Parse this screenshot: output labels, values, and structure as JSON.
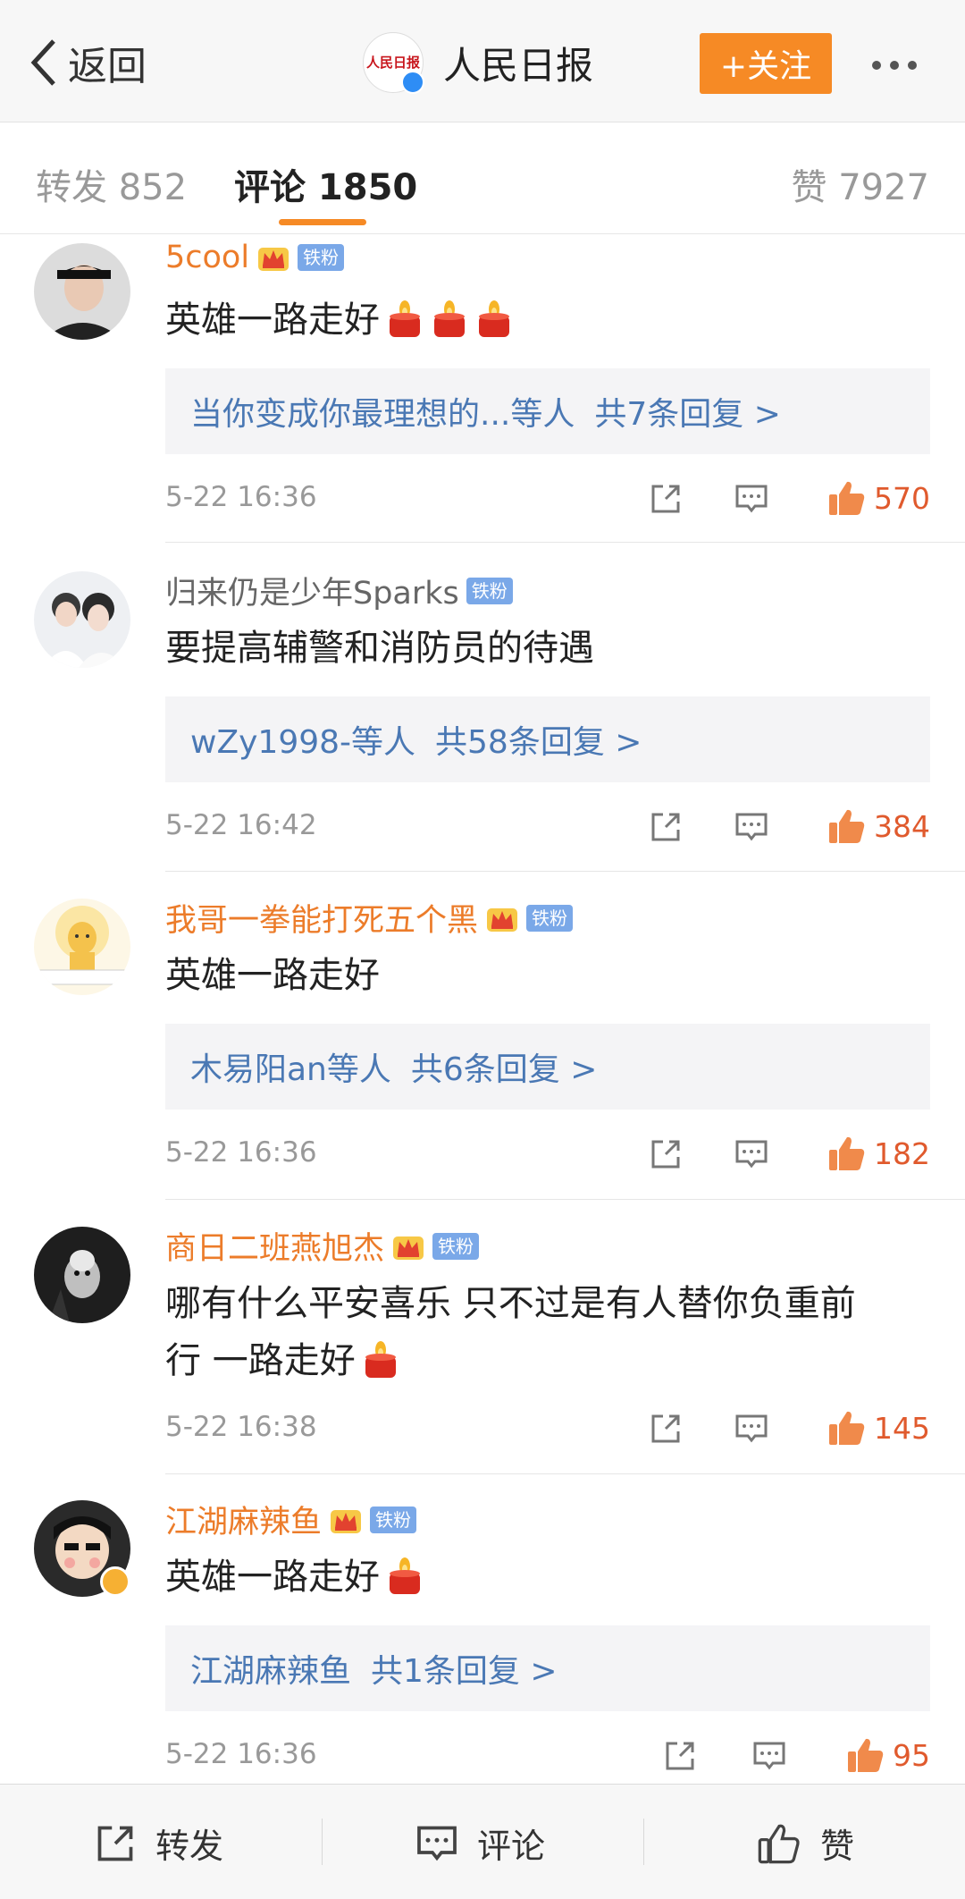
{
  "nav": {
    "back_label": "返回",
    "account_name": "人民日报",
    "logo_text": "人民日报",
    "follow_label": "+关注"
  },
  "tabs": {
    "repost": "转发 852",
    "comments": "评论 1850",
    "likes": "赞 7927"
  },
  "comments": [
    {
      "user": "5cool",
      "vip": true,
      "fan_badge": "铁粉",
      "text": "英雄一路走好",
      "candles": 3,
      "reply_users": "当你变成你最理想的...等人",
      "reply_count": "共7条回复 >",
      "time": "5-22 16:36",
      "likes": "570"
    },
    {
      "user": "归来仍是少年Sparks",
      "vip": false,
      "fan_badge": "铁粉",
      "text": "要提高辅警和消防员的待遇",
      "candles": 0,
      "reply_users": "wZy1998-等人",
      "reply_count": "共58条回复 >",
      "time": "5-22 16:42",
      "likes": "384"
    },
    {
      "user": "我哥一拳能打死五个黑",
      "vip": true,
      "fan_badge": "铁粉",
      "text": "英雄一路走好",
      "candles": 0,
      "reply_users": "木易阳an等人",
      "reply_count": "共6条回复 >",
      "time": "5-22 16:36",
      "likes": "182"
    },
    {
      "user": "商日二班燕旭杰",
      "vip": true,
      "fan_badge": "铁粉",
      "text_line1": "哪有什么平安喜乐 只不过是有人替你负重前",
      "text_line2": "行 一路走好",
      "candles": 1,
      "time": "5-22 16:38",
      "likes": "145"
    },
    {
      "user": "江湖麻辣鱼",
      "vip": true,
      "fan_badge": "铁粉",
      "text": "英雄一路走好",
      "candles": 1,
      "reply_users": "江湖麻辣鱼",
      "reply_count": "共1条回复 >",
      "time": "5-22 16:36",
      "likes": "95"
    }
  ],
  "bottom_bar": {
    "repost": "转发",
    "comment": "评论",
    "like": "赞"
  },
  "colors": {
    "accent": "#f68a25",
    "vip_name": "#ec7c2a",
    "reply_link": "#4a78b4",
    "like_count": "#e05a2d"
  }
}
